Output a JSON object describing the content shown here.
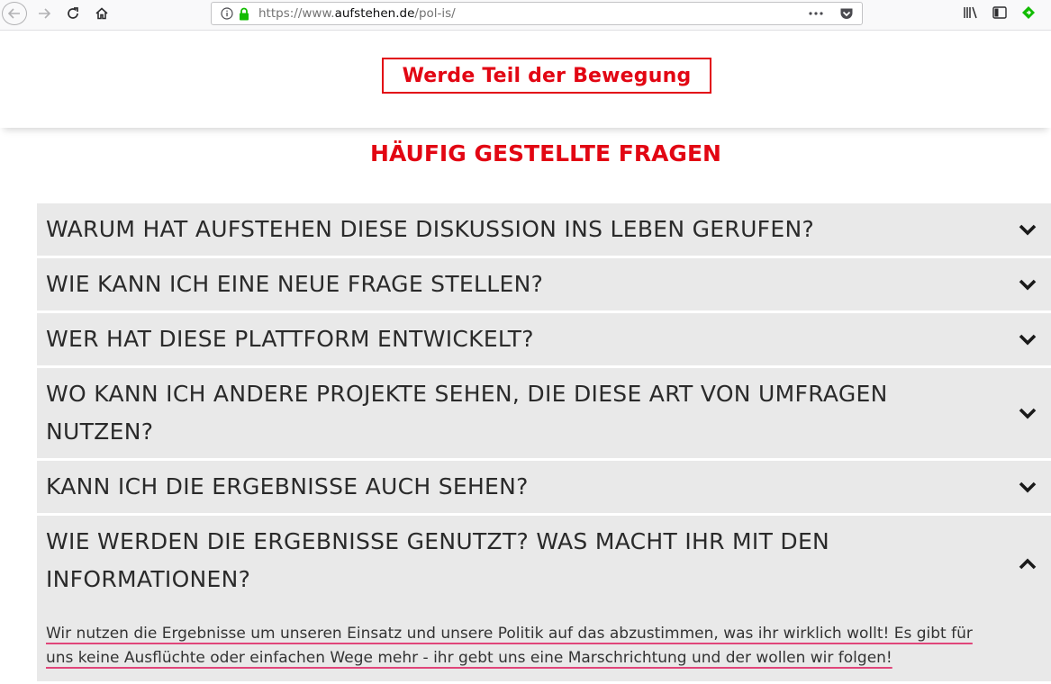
{
  "browser": {
    "url_prefix": "https://www.",
    "url_host": "aufstehen.de",
    "url_path": "/pol-is/"
  },
  "header": {
    "join_label": "Werde Teil der Bewegung"
  },
  "faq": {
    "title": "HÄUFIG GESTELLTE FRAGEN",
    "items": [
      {
        "question": "WARUM HAT AUFSTEHEN DIESE DISKUSSION INS LEBEN GERUFEN?"
      },
      {
        "question": "WIE KANN ICH EINE NEUE FRAGE STELLEN?"
      },
      {
        "question": "WER HAT DIESE PLATTFORM ENTWICKELT?"
      },
      {
        "question": "WO KANN ICH ANDERE PROJEKTE SEHEN, DIE DIESE ART VON UMFRAGEN NUTZEN?"
      },
      {
        "question": "KANN ICH DIE ERGEBNISSE AUCH SEHEN?"
      },
      {
        "question": "WIE WERDEN DIE ERGEBNISSE GENUTZT? WAS MACHT IHR MIT DEN INFORMATIONEN?",
        "answer": "Wir nutzen die Ergebnisse um unseren Einsatz und unsere Politik auf das abzustimmen, was ihr wirklich wollt! Es gibt für uns keine Ausflüchte oder einfachen Wege mehr - ihr gebt uns eine Marschrichtung und der wollen wir folgen!"
      }
    ]
  },
  "colors": {
    "accent": "#e20613",
    "faq_bg": "#e9e9e9",
    "highlight": "#e0457a"
  }
}
